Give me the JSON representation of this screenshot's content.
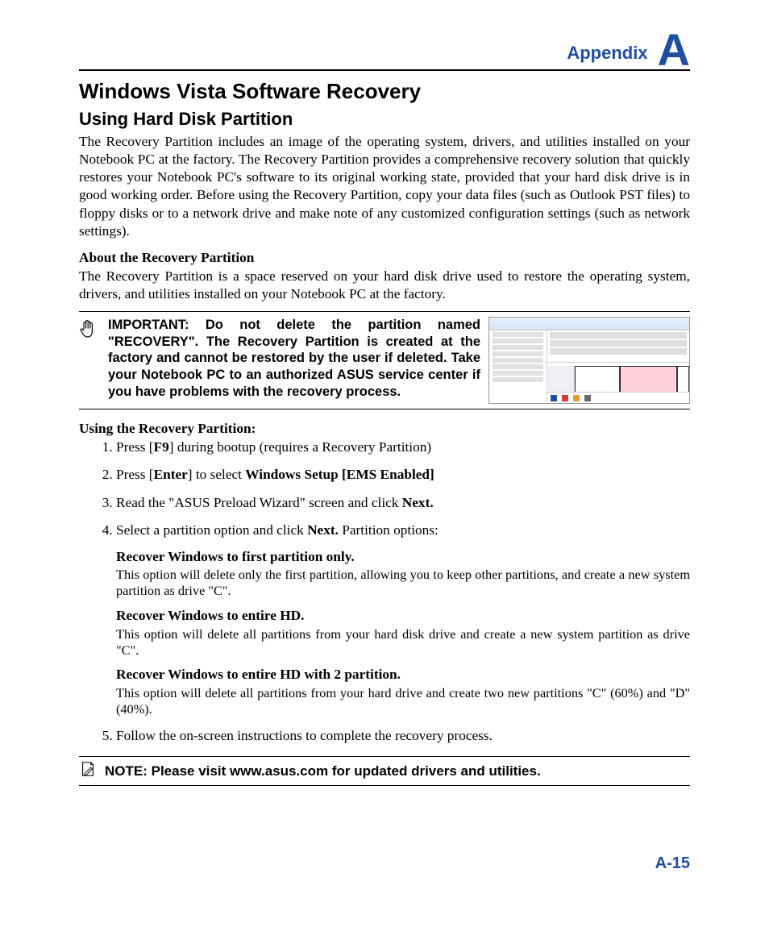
{
  "header": {
    "appendix_label": "Appendix",
    "appendix_letter": "A"
  },
  "title": "Windows Vista Software Recovery",
  "subtitle": "Using Hard Disk Partition",
  "intro": "The Recovery Partition includes an image of the operating system, drivers, and utilities installed on your Notebook PC at the factory. The Recovery Partition provides a comprehensive recovery solution that quickly restores your Notebook PC's software to its original working state, provided that your hard disk drive is in good working order. Before using the Recovery Partition, copy your data files (such as Outlook PST files) to floppy disks or to a network drive and make note of any customized configuration settings (such as network settings).",
  "about_head": "About the Recovery Partition",
  "about_body": "The Recovery Partition is a space reserved on your hard disk drive used to restore the operating system, drivers, and utilities installed on your Notebook PC at the factory.",
  "important_box": "IMPORTANT: Do not delete the partition named \"RECOVERY\". The Recovery Partition is created at the factory and cannot be restored by the user if deleted. Take your Notebook PC to an authorized ASUS service center if you have problems with the recovery process.",
  "steps_head": "Using the Recovery Partition:",
  "steps": {
    "s1a": "Press [",
    "s1b": "F9",
    "s1c": "] during bootup (requires a Recovery Partition)",
    "s2a": "Press [",
    "s2b": "Enter",
    "s2c": "] to select ",
    "s2d": "Windows Setup [EMS Enabled]",
    "s3a": "Read the \"ASUS Preload Wizard\" screen and click ",
    "s3b": "Next.",
    "s4a": "Select a partition option and click ",
    "s4b": "Next.",
    "s4c": " Partition options:",
    "opt1h": "Recover Windows to first partition only.",
    "opt1b": "This option will delete only the first partition, allowing you to keep other partitions, and create a new system partition as drive \"C\".",
    "opt2h": "Recover Windows to entire HD.",
    "opt2b": "This option will delete all partitions from your hard disk drive and create a new system partition as drive \"C\".",
    "opt3h": "Recover Windows to entire HD with 2 partition.",
    "opt3b": "This option will delete all partitions from your hard drive and create two new partitions \"C\" (60%) and \"D\" (40%).",
    "s5": "Follow the on-screen instructions to complete the recovery process."
  },
  "note": "NOTE: Please visit www.asus.com for updated drivers and utilities.",
  "page_number": "A-15"
}
